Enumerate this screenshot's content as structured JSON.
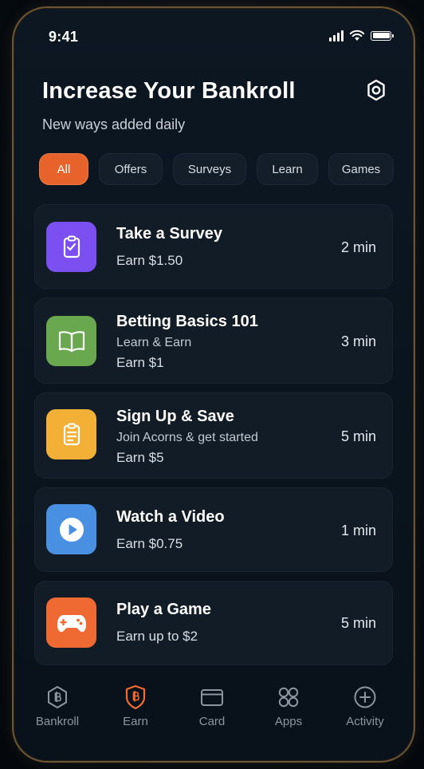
{
  "status_bar": {
    "time": "9:41"
  },
  "header": {
    "title": "Increase Your Bankroll",
    "subtitle": "New ways added daily"
  },
  "filters": [
    {
      "label": "All",
      "active": true
    },
    {
      "label": "Offers",
      "active": false
    },
    {
      "label": "Surveys",
      "active": false
    },
    {
      "label": "Learn",
      "active": false
    },
    {
      "label": "Games",
      "active": false
    }
  ],
  "tasks": [
    {
      "title": "Take a Survey",
      "subtitle": "",
      "earn": "Earn $1.50",
      "duration": "2 min",
      "icon": "clipboard-icon",
      "color": "#7b4ff0"
    },
    {
      "title": "Betting Basics 101",
      "subtitle": "Learn & Earn",
      "earn": "Earn $1",
      "duration": "3 min",
      "icon": "book-icon",
      "color": "#6aa84f"
    },
    {
      "title": "Sign Up & Save",
      "subtitle": "Join Acorns & get started",
      "earn": "Earn $5",
      "duration": "5 min",
      "icon": "clipboard-list-icon",
      "color": "#f2b037"
    },
    {
      "title": "Watch a Video",
      "subtitle": "",
      "earn": "Earn $0.75",
      "duration": "1 min",
      "icon": "play-icon",
      "color": "#4a90e2"
    },
    {
      "title": "Play a Game",
      "subtitle": "",
      "earn": "Earn up to $2",
      "duration": "5 min",
      "icon": "gamepad-icon",
      "color": "#ee6a32"
    }
  ],
  "tabbar": [
    {
      "label": "Bankroll",
      "icon": "bankroll-icon",
      "active": false
    },
    {
      "label": "Earn",
      "icon": "earn-badge-icon",
      "active": true
    },
    {
      "label": "Card",
      "icon": "card-icon",
      "active": false
    },
    {
      "label": "Apps",
      "icon": "apps-grid-icon",
      "active": false
    },
    {
      "label": "Activity",
      "icon": "activity-plus-icon",
      "active": false
    }
  ],
  "colors": {
    "accent": "#e8622b",
    "background": "#0a141d"
  }
}
